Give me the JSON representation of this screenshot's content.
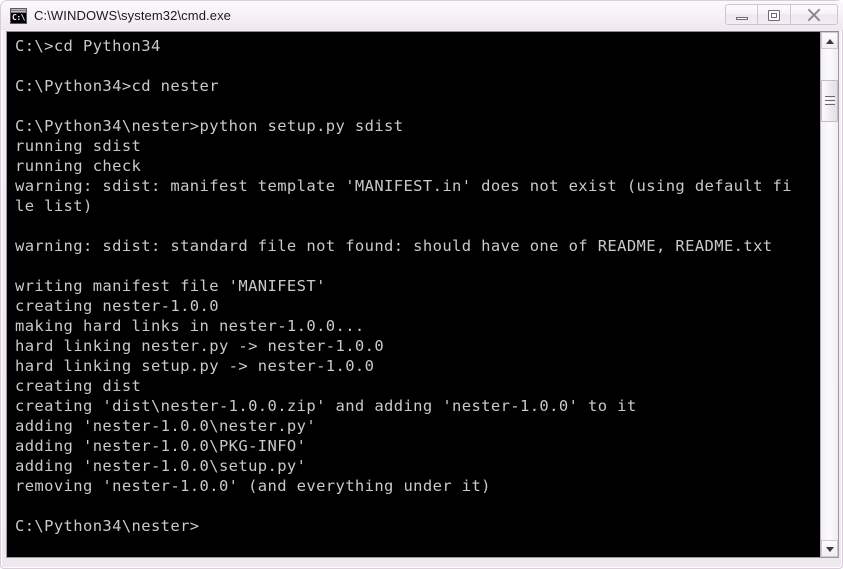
{
  "window": {
    "title": "C:\\WINDOWS\\system32\\cmd.exe",
    "icon_name": "cmd-console-icon",
    "icon_prompt_text": "C:\\.",
    "controls": {
      "minimize_label": "Minimize",
      "restore_label": "Restore Down",
      "close_label": "Close"
    }
  },
  "console": {
    "background_color": "#000000",
    "text_color": "#c9c9c9",
    "lines": [
      "C:\\>cd Python34",
      "",
      "C:\\Python34>cd nester",
      "",
      "C:\\Python34\\nester>python setup.py sdist",
      "running sdist",
      "running check",
      "warning: sdist: manifest template 'MANIFEST.in' does not exist (using default fi",
      "le list)",
      "",
      "warning: sdist: standard file not found: should have one of README, README.txt",
      "",
      "writing manifest file 'MANIFEST'",
      "creating nester-1.0.0",
      "making hard links in nester-1.0.0...",
      "hard linking nester.py -> nester-1.0.0",
      "hard linking setup.py -> nester-1.0.0",
      "creating dist",
      "creating 'dist\\nester-1.0.0.zip' and adding 'nester-1.0.0' to it",
      "adding 'nester-1.0.0\\nester.py'",
      "adding 'nester-1.0.0\\PKG-INFO'",
      "adding 'nester-1.0.0\\setup.py'",
      "removing 'nester-1.0.0' (and everything under it)",
      "",
      "C:\\Python34\\nester>"
    ]
  },
  "scrollbar": {
    "up_arrow_name": "scroll-up-arrow",
    "down_arrow_name": "scroll-down-arrow",
    "thumb_name": "scrollbar-thumb"
  }
}
